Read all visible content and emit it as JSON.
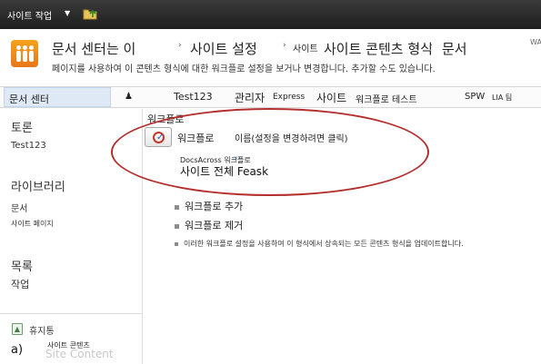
{
  "ribbon": {
    "site_actions": "사이트 작업",
    "site_actions_arrow": "▼",
    "folder_up_icon": "folder-up-icon"
  },
  "breadcrumb": {
    "items": [
      "문서 센터는 이",
      "사이트 설정",
      "사이트 콘텐츠 형식",
      "문서"
    ],
    "small_prefix": "사이트",
    "separator": "›",
    "clip": "WA"
  },
  "page": {
    "description": "페이지를 사용하여 이 콘텐츠 형식에 대한 워크플로 설정을 보거나 변경합니다. 추가할 수도 있습니다."
  },
  "topnav": {
    "home": "문서 센터",
    "items": [
      "Test123",
      "관리자",
      "Express",
      "사이트",
      "워크플로 테스트",
      "SPW",
      "LIA 팀"
    ]
  },
  "quicklaunch": {
    "headings": [
      "토론",
      "라이브러리",
      "목록"
    ],
    "items": [
      "Test123",
      "문서",
      "사이트 페이지",
      "작업"
    ],
    "recycle": "휴지통",
    "bottom_letter": "a)",
    "bottom_small": "사이트 콘텐츠",
    "bottom_ghost": "Site Content"
  },
  "main": {
    "section": "워크플로",
    "col_workflow": "워크플로",
    "col_name": "이름(설정을 변경하려면 클릭)",
    "row_small": "DocsAcross 워크플로",
    "row_big": "사이트 전체 Feask",
    "links": [
      "워크플로 추가",
      "워크플로 제거"
    ],
    "update_text": "이러한 워크플로 설정을 사용하여 이 형식에서 상속되는 모든 콘텐츠 형식을 업데이트합니다."
  },
  "colors": {
    "ribbon": "#2b2b2b",
    "annotation": "#b3302f",
    "nav_selected": "#dfe9f6",
    "logo": "#f08c1a"
  }
}
